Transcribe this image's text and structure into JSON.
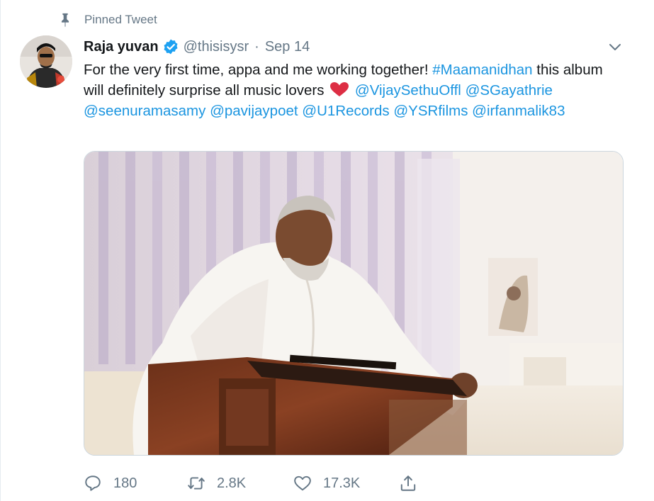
{
  "pinned": {
    "label": "Pinned Tweet"
  },
  "author": {
    "display_name": "Raja yuvan",
    "handle": "@thisisysr",
    "separator": "·",
    "date": "Sep 14"
  },
  "tweet": {
    "text_part1": "For the very first time, appa and me working together! ",
    "hashtag": "#Maamanidhan",
    "text_part2": " this album will definitely surprise all music lovers ",
    "mentions": [
      "@VijaySethuOffl",
      "@SGayathrie",
      "@seenuramasamy",
      "@pavijaypoet",
      "@U1Records",
      "@YSRfilms",
      "@irfanmalik83"
    ]
  },
  "actions": {
    "reply_count": "180",
    "retweet_count": "2.8K",
    "like_count": "17.3K"
  },
  "colors": {
    "link": "#1b95e0",
    "secondary": "#657786",
    "verified": "#1da1f2",
    "heart": "#e0245e"
  },
  "icons": {
    "pin": "pin-icon",
    "verified": "verified-badge-icon",
    "caret": "chevron-down-icon",
    "heart_emoji": "red-heart-icon",
    "reply": "reply-icon",
    "retweet": "retweet-icon",
    "like": "like-icon",
    "share": "share-icon"
  }
}
